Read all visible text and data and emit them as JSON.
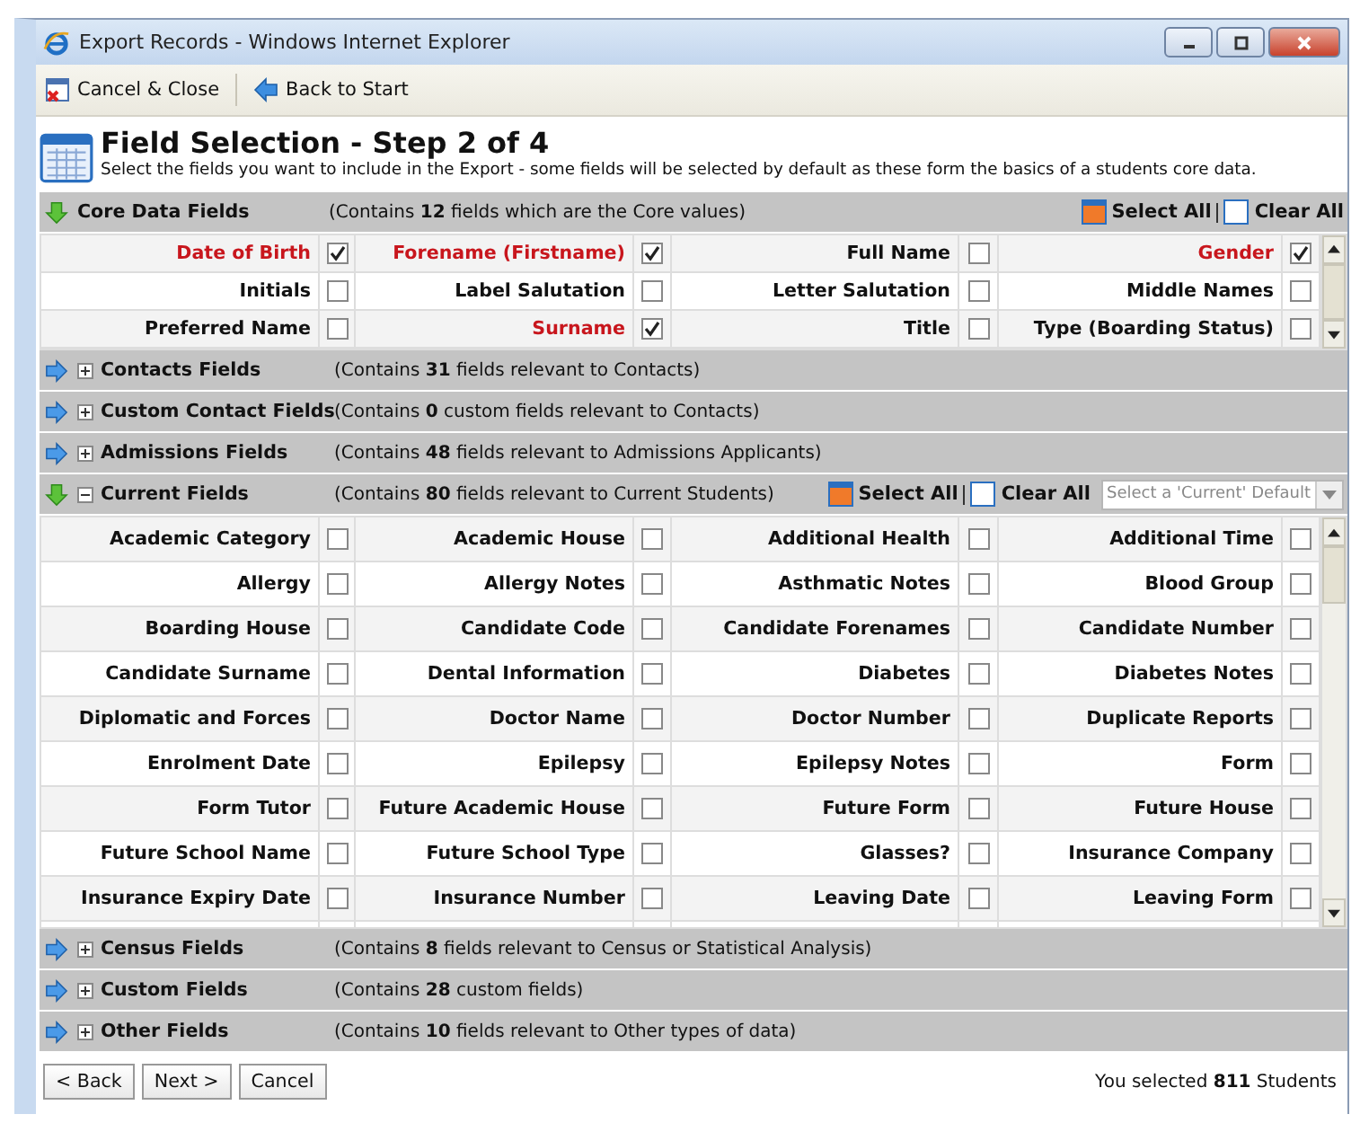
{
  "window": {
    "title": "Export Records - Windows Internet Explorer"
  },
  "toolbar": [
    {
      "label": "Cancel & Close",
      "kind": "cancel"
    },
    {
      "label": "Back to Start",
      "kind": "back"
    }
  ],
  "heading": {
    "title": "Field Selection - Step 2 of 4",
    "subtitle": "Select the fields you want to include in the Export - some fields will be selected by default as these form the basics of a students core data."
  },
  "sections": [
    {
      "title": "Core Data Fields",
      "description": "(Contains **12** fields which are the Core values)",
      "expanded": true,
      "toggle": false,
      "select_all": "Select All",
      "clear_all": "Clear All",
      "fields": [
        {
          "label": "Date of Birth",
          "checked": true,
          "required": true
        },
        {
          "label": "Forename (Firstname)",
          "checked": true,
          "required": true
        },
        {
          "label": "Full Name",
          "checked": false,
          "required": false
        },
        {
          "label": "Gender",
          "checked": true,
          "required": true
        },
        {
          "label": "Initials",
          "checked": false,
          "required": false
        },
        {
          "label": "Label Salutation",
          "checked": false,
          "required": false
        },
        {
          "label": "Letter Salutation",
          "checked": false,
          "required": false
        },
        {
          "label": "Middle Names",
          "checked": false,
          "required": false
        },
        {
          "label": "Preferred Name",
          "checked": false,
          "required": false
        },
        {
          "label": "Surname",
          "checked": true,
          "required": true
        },
        {
          "label": "Title",
          "checked": false,
          "required": false
        },
        {
          "label": "Type (Boarding Status)",
          "checked": false,
          "required": false
        }
      ]
    },
    {
      "title": "Contacts Fields",
      "description": "(Contains **31** fields relevant to Contacts)",
      "expanded": false,
      "toggle": true
    },
    {
      "title": "Custom Contact Fields",
      "description": "(Contains **0** custom fields relevant to Contacts)",
      "expanded": false,
      "toggle": true
    },
    {
      "title": "Admissions Fields",
      "description": "(Contains **48** fields relevant to Admissions Applicants)",
      "expanded": false,
      "toggle": true
    },
    {
      "title": "Current Fields",
      "description": "(Contains **80** fields relevant to Current Students)",
      "expanded": true,
      "toggle": true,
      "select_all": "Select All",
      "clear_all": "Clear All",
      "default_placeholder": "Select a 'Current' Default",
      "fields": [
        {
          "label": "Academic Category",
          "checked": false,
          "required": false
        },
        {
          "label": "Academic House",
          "checked": false,
          "required": false
        },
        {
          "label": "Additional Health",
          "checked": false,
          "required": false
        },
        {
          "label": "Additional Time",
          "checked": false,
          "required": false
        },
        {
          "label": "Allergy",
          "checked": false,
          "required": false
        },
        {
          "label": "Allergy Notes",
          "checked": false,
          "required": false
        },
        {
          "label": "Asthmatic Notes",
          "checked": false,
          "required": false
        },
        {
          "label": "Blood Group",
          "checked": false,
          "required": false
        },
        {
          "label": "Boarding House",
          "checked": false,
          "required": false
        },
        {
          "label": "Candidate Code",
          "checked": false,
          "required": false
        },
        {
          "label": "Candidate Forenames",
          "checked": false,
          "required": false
        },
        {
          "label": "Candidate Number",
          "checked": false,
          "required": false
        },
        {
          "label": "Candidate Surname",
          "checked": false,
          "required": false
        },
        {
          "label": "Dental Information",
          "checked": false,
          "required": false
        },
        {
          "label": "Diabetes",
          "checked": false,
          "required": false
        },
        {
          "label": "Diabetes Notes",
          "checked": false,
          "required": false
        },
        {
          "label": "Diplomatic and Forces",
          "checked": false,
          "required": false
        },
        {
          "label": "Doctor Name",
          "checked": false,
          "required": false
        },
        {
          "label": "Doctor Number",
          "checked": false,
          "required": false
        },
        {
          "label": "Duplicate Reports",
          "checked": false,
          "required": false
        },
        {
          "label": "Enrolment Date",
          "checked": false,
          "required": false
        },
        {
          "label": "Epilepsy",
          "checked": false,
          "required": false
        },
        {
          "label": "Epilepsy Notes",
          "checked": false,
          "required": false
        },
        {
          "label": "Form",
          "checked": false,
          "required": false
        },
        {
          "label": "Form Tutor",
          "checked": false,
          "required": false
        },
        {
          "label": "Future Academic House",
          "checked": false,
          "required": false
        },
        {
          "label": "Future Form",
          "checked": false,
          "required": false
        },
        {
          "label": "Future House",
          "checked": false,
          "required": false
        },
        {
          "label": "Future School Name",
          "checked": false,
          "required": false
        },
        {
          "label": "Future School Type",
          "checked": false,
          "required": false
        },
        {
          "label": "Glasses?",
          "checked": false,
          "required": false
        },
        {
          "label": "Insurance Company",
          "checked": false,
          "required": false
        },
        {
          "label": "Insurance Expiry Date",
          "checked": false,
          "required": false
        },
        {
          "label": "Insurance Number",
          "checked": false,
          "required": false
        },
        {
          "label": "Leaving Date",
          "checked": false,
          "required": false
        },
        {
          "label": "Leaving Form",
          "checked": false,
          "required": false
        }
      ]
    },
    {
      "title": "Census Fields",
      "description": "(Contains **8** fields relevant to Census or Statistical Analysis)",
      "expanded": false,
      "toggle": true
    },
    {
      "title": "Custom Fields",
      "description": "(Contains **28** custom fields)",
      "expanded": false,
      "toggle": true
    },
    {
      "title": "Other Fields",
      "description": "(Contains **10** fields relevant to Other types of data)",
      "expanded": false,
      "toggle": true
    }
  ],
  "buttons": [
    "< Back",
    "Next >",
    "Cancel"
  ],
  "status": "You selected **811** Students"
}
